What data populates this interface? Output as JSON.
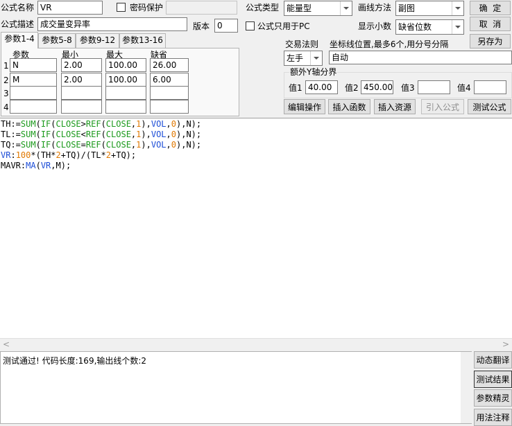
{
  "formula_name": {
    "label": "公式名称",
    "value": "VR"
  },
  "password": {
    "label": "密码保护",
    "checked": false
  },
  "formula_type": {
    "label": "公式类型",
    "value": "能量型"
  },
  "draw_method": {
    "label": "画线方法",
    "value": "副图"
  },
  "confirm_button": "确  定",
  "cancel_button": "取  消",
  "save_as_button": "另存为",
  "description": {
    "label": "公式描述",
    "value": "成交量变异率"
  },
  "version": {
    "label": "版本",
    "value": "0"
  },
  "pc_only": {
    "label": "公式只用于PC",
    "checked": false
  },
  "decimals": {
    "label": "显示小数",
    "value": "缺省位数"
  },
  "tabs": [
    "参数1-4",
    "参数5-8",
    "参数9-12",
    "参数13-16"
  ],
  "param_headers": [
    "参数",
    "最小",
    "最大",
    "缺省"
  ],
  "params": [
    {
      "num": "1",
      "name": "N",
      "min": "2.00",
      "max": "100.00",
      "default": "26.00"
    },
    {
      "num": "2",
      "name": "M",
      "min": "2.00",
      "max": "100.00",
      "default": "6.00"
    },
    {
      "num": "3",
      "name": "",
      "min": "",
      "max": "",
      "default": ""
    },
    {
      "num": "4",
      "name": "",
      "min": "",
      "max": "",
      "default": ""
    }
  ],
  "trade_rule": {
    "label": "交易法则",
    "value": "左手"
  },
  "axis_position": {
    "label": "坐标线位置,最多6个,用分号分隔",
    "value": "自动"
  },
  "y_axis": {
    "title": "额外Y轴分界",
    "v1_label": "值1",
    "v1": "40.00",
    "v2_label": "值2",
    "v2": "450.00",
    "v3_label": "值3",
    "v3": "",
    "v4_label": "值4",
    "v4": ""
  },
  "action_buttons": {
    "edit": "编辑操作",
    "insert_func": "插入函数",
    "insert_res": "插入资源",
    "import": "引入公式",
    "test": "测试公式"
  },
  "code_lines": [
    [
      [
        "id",
        "TH:="
      ],
      [
        "fn",
        "SUM"
      ],
      [
        "pl",
        "("
      ],
      [
        "fn",
        "IF"
      ],
      [
        "pl",
        "("
      ],
      [
        "fn",
        "CLOSE"
      ],
      [
        "pl",
        ">"
      ],
      [
        "fn",
        "REF"
      ],
      [
        "pl",
        "("
      ],
      [
        "fn",
        "CLOSE"
      ],
      [
        "pl",
        ","
      ],
      [
        "num",
        "1"
      ],
      [
        "pl",
        "),"
      ],
      [
        "kw",
        "VOL"
      ],
      [
        "pl",
        ","
      ],
      [
        "num",
        "0"
      ],
      [
        "pl",
        "),N);"
      ]
    ],
    [
      [
        "id",
        "TL:="
      ],
      [
        "fn",
        "SUM"
      ],
      [
        "pl",
        "("
      ],
      [
        "fn",
        "IF"
      ],
      [
        "pl",
        "("
      ],
      [
        "fn",
        "CLOSE"
      ],
      [
        "pl",
        "<"
      ],
      [
        "fn",
        "REF"
      ],
      [
        "pl",
        "("
      ],
      [
        "fn",
        "CLOSE"
      ],
      [
        "pl",
        ","
      ],
      [
        "num",
        "1"
      ],
      [
        "pl",
        "),"
      ],
      [
        "kw",
        "VOL"
      ],
      [
        "pl",
        ","
      ],
      [
        "num",
        "0"
      ],
      [
        "pl",
        "),N);"
      ]
    ],
    [
      [
        "id",
        "TQ:="
      ],
      [
        "fn",
        "SUM"
      ],
      [
        "pl",
        "("
      ],
      [
        "fn",
        "IF"
      ],
      [
        "pl",
        "("
      ],
      [
        "fn",
        "CLOSE"
      ],
      [
        "pl",
        "="
      ],
      [
        "fn",
        "REF"
      ],
      [
        "pl",
        "("
      ],
      [
        "fn",
        "CLOSE"
      ],
      [
        "pl",
        ","
      ],
      [
        "num",
        "1"
      ],
      [
        "pl",
        "),"
      ],
      [
        "kw",
        "VOL"
      ],
      [
        "pl",
        ","
      ],
      [
        "num",
        "0"
      ],
      [
        "pl",
        "),N);"
      ]
    ],
    [
      [
        "kw",
        "VR"
      ],
      [
        "pl",
        ":"
      ],
      [
        "num",
        "100"
      ],
      [
        "pl",
        "*(TH*"
      ],
      [
        "num",
        "2"
      ],
      [
        "pl",
        "+TQ)/(TL*"
      ],
      [
        "num",
        "2"
      ],
      [
        "pl",
        "+TQ);"
      ]
    ],
    [
      [
        "id",
        "MAVR:"
      ],
      [
        "kw",
        "MA"
      ],
      [
        "pl",
        "("
      ],
      [
        "kw",
        "VR"
      ],
      [
        "pl",
        ",M);"
      ]
    ]
  ],
  "result_text": "测试通过! 代码长度:169,输出线个数:2",
  "side_buttons": [
    "动态翻译",
    "测试结果",
    "参数精灵",
    "用法注释"
  ]
}
